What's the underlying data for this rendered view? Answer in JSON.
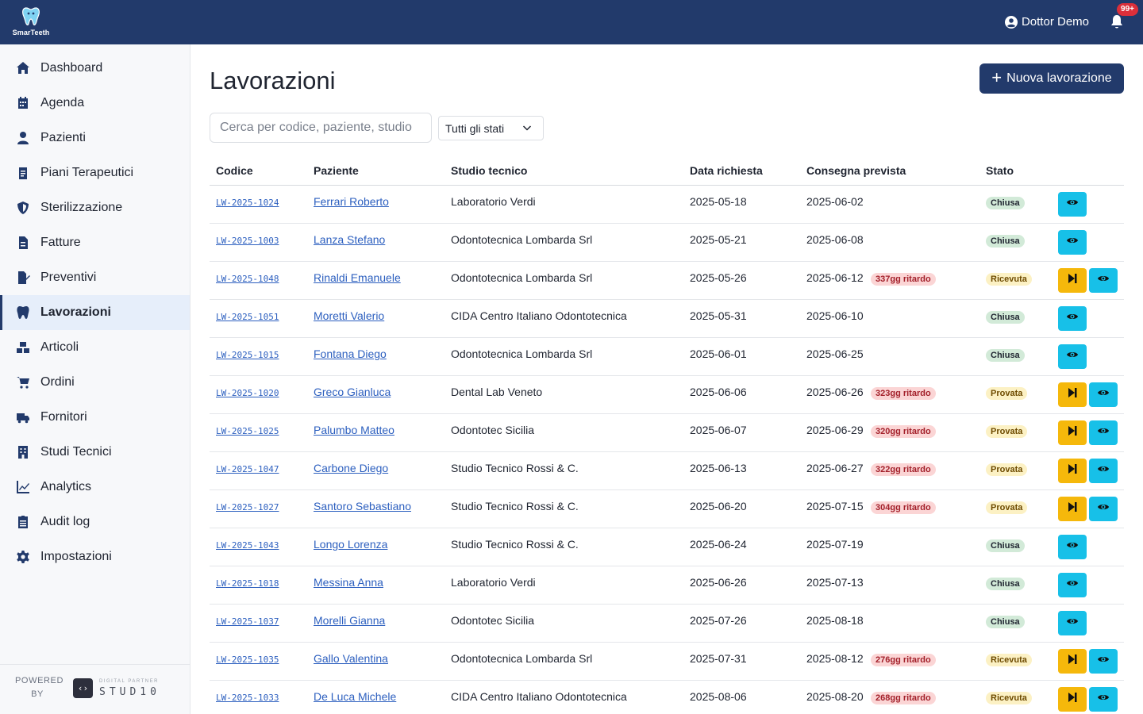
{
  "app": {
    "logo_text": "SmarTeeth",
    "user_name": "Dottor Demo",
    "notifications_badge": "99+"
  },
  "sidebar": {
    "items": [
      {
        "label": "Dashboard",
        "icon": "home-icon"
      },
      {
        "label": "Agenda",
        "icon": "calendar-icon"
      },
      {
        "label": "Pazienti",
        "icon": "user-icon"
      },
      {
        "label": "Piani Terapeutici",
        "icon": "clipboard-icon"
      },
      {
        "label": "Sterilizzazione",
        "icon": "shield-icon"
      },
      {
        "label": "Fatture",
        "icon": "invoice-icon"
      },
      {
        "label": "Preventivi",
        "icon": "file-signature-icon"
      },
      {
        "label": "Lavorazioni",
        "icon": "tooth-icon"
      },
      {
        "label": "Articoli",
        "icon": "boxes-icon"
      },
      {
        "label": "Ordini",
        "icon": "cart-icon"
      },
      {
        "label": "Fornitori",
        "icon": "truck-icon"
      },
      {
        "label": "Studi Tecnici",
        "icon": "building-icon"
      },
      {
        "label": "Analytics",
        "icon": "chart-line-icon"
      },
      {
        "label": "Audit log",
        "icon": "clipboard-list-icon"
      },
      {
        "label": "Impostazioni",
        "icon": "gear-icon"
      }
    ],
    "active_index": 7,
    "powered_line1": "POWERED",
    "powered_line2": "BY",
    "studio_sub": "DIGITAL PARTNER",
    "studio_name": "STUD10"
  },
  "main": {
    "title": "Lavorazioni",
    "new_button": "Nuova lavorazione",
    "search_placeholder": "Cerca per codice, paziente, studio",
    "status_filter": "Tutti gli stati"
  },
  "table": {
    "headers": [
      "Codice",
      "Paziente",
      "Studio tecnico",
      "Data richiesta",
      "Consegna prevista",
      "Stato"
    ],
    "rows": [
      {
        "code": "LW-2025-1024",
        "patient": "Ferrari Roberto",
        "studio": "Laboratorio Verdi",
        "requested": "2025-05-18",
        "due": "2025-06-02",
        "delay": "",
        "status": "Chiusa"
      },
      {
        "code": "LW-2025-1003",
        "patient": "Lanza Stefano",
        "studio": "Odontotecnica Lombarda Srl",
        "requested": "2025-05-21",
        "due": "2025-06-08",
        "delay": "",
        "status": "Chiusa"
      },
      {
        "code": "LW-2025-1048",
        "patient": "Rinaldi Emanuele",
        "studio": "Odontotecnica Lombarda Srl",
        "requested": "2025-05-26",
        "due": "2025-06-12",
        "delay": "337gg ritardo",
        "status": "Ricevuta"
      },
      {
        "code": "LW-2025-1051",
        "patient": "Moretti Valerio",
        "studio": "CIDA Centro Italiano Odontotecnica",
        "requested": "2025-05-31",
        "due": "2025-06-10",
        "delay": "",
        "status": "Chiusa"
      },
      {
        "code": "LW-2025-1015",
        "patient": "Fontana Diego",
        "studio": "Odontotecnica Lombarda Srl",
        "requested": "2025-06-01",
        "due": "2025-06-25",
        "delay": "",
        "status": "Chiusa"
      },
      {
        "code": "LW-2025-1020",
        "patient": "Greco Gianluca",
        "studio": "Dental Lab Veneto",
        "requested": "2025-06-06",
        "due": "2025-06-26",
        "delay": "323gg ritardo",
        "status": "Provata"
      },
      {
        "code": "LW-2025-1025",
        "patient": "Palumbo Matteo",
        "studio": "Odontotec Sicilia",
        "requested": "2025-06-07",
        "due": "2025-06-29",
        "delay": "320gg ritardo",
        "status": "Provata"
      },
      {
        "code": "LW-2025-1047",
        "patient": "Carbone Diego",
        "studio": "Studio Tecnico Rossi & C.",
        "requested": "2025-06-13",
        "due": "2025-06-27",
        "delay": "322gg ritardo",
        "status": "Provata"
      },
      {
        "code": "LW-2025-1027",
        "patient": "Santoro Sebastiano",
        "studio": "Studio Tecnico Rossi & C.",
        "requested": "2025-06-20",
        "due": "2025-07-15",
        "delay": "304gg ritardo",
        "status": "Provata"
      },
      {
        "code": "LW-2025-1043",
        "patient": "Longo Lorenza",
        "studio": "Studio Tecnico Rossi & C.",
        "requested": "2025-06-24",
        "due": "2025-07-19",
        "delay": "",
        "status": "Chiusa"
      },
      {
        "code": "LW-2025-1018",
        "patient": "Messina Anna",
        "studio": "Laboratorio Verdi",
        "requested": "2025-06-26",
        "due": "2025-07-13",
        "delay": "",
        "status": "Chiusa"
      },
      {
        "code": "LW-2025-1037",
        "patient": "Morelli Gianna",
        "studio": "Odontotec Sicilia",
        "requested": "2025-07-26",
        "due": "2025-08-18",
        "delay": "",
        "status": "Chiusa"
      },
      {
        "code": "LW-2025-1035",
        "patient": "Gallo Valentina",
        "studio": "Odontotecnica Lombarda Srl",
        "requested": "2025-07-31",
        "due": "2025-08-12",
        "delay": "276gg ritardo",
        "status": "Ricevuta"
      },
      {
        "code": "LW-2025-1033",
        "patient": "De Luca Michele",
        "studio": "CIDA Centro Italiano Odontotecnica",
        "requested": "2025-08-06",
        "due": "2025-08-20",
        "delay": "268gg ritardo",
        "status": "Ricevuta"
      }
    ]
  },
  "colors": {
    "primary": "#223a6b",
    "view_button": "#17c0e8",
    "advance_button": "#f5b80b",
    "delay_badge": "#fbd5d5",
    "closed_badge": "#d2ead8",
    "pending_badge": "#fcf1c4"
  }
}
